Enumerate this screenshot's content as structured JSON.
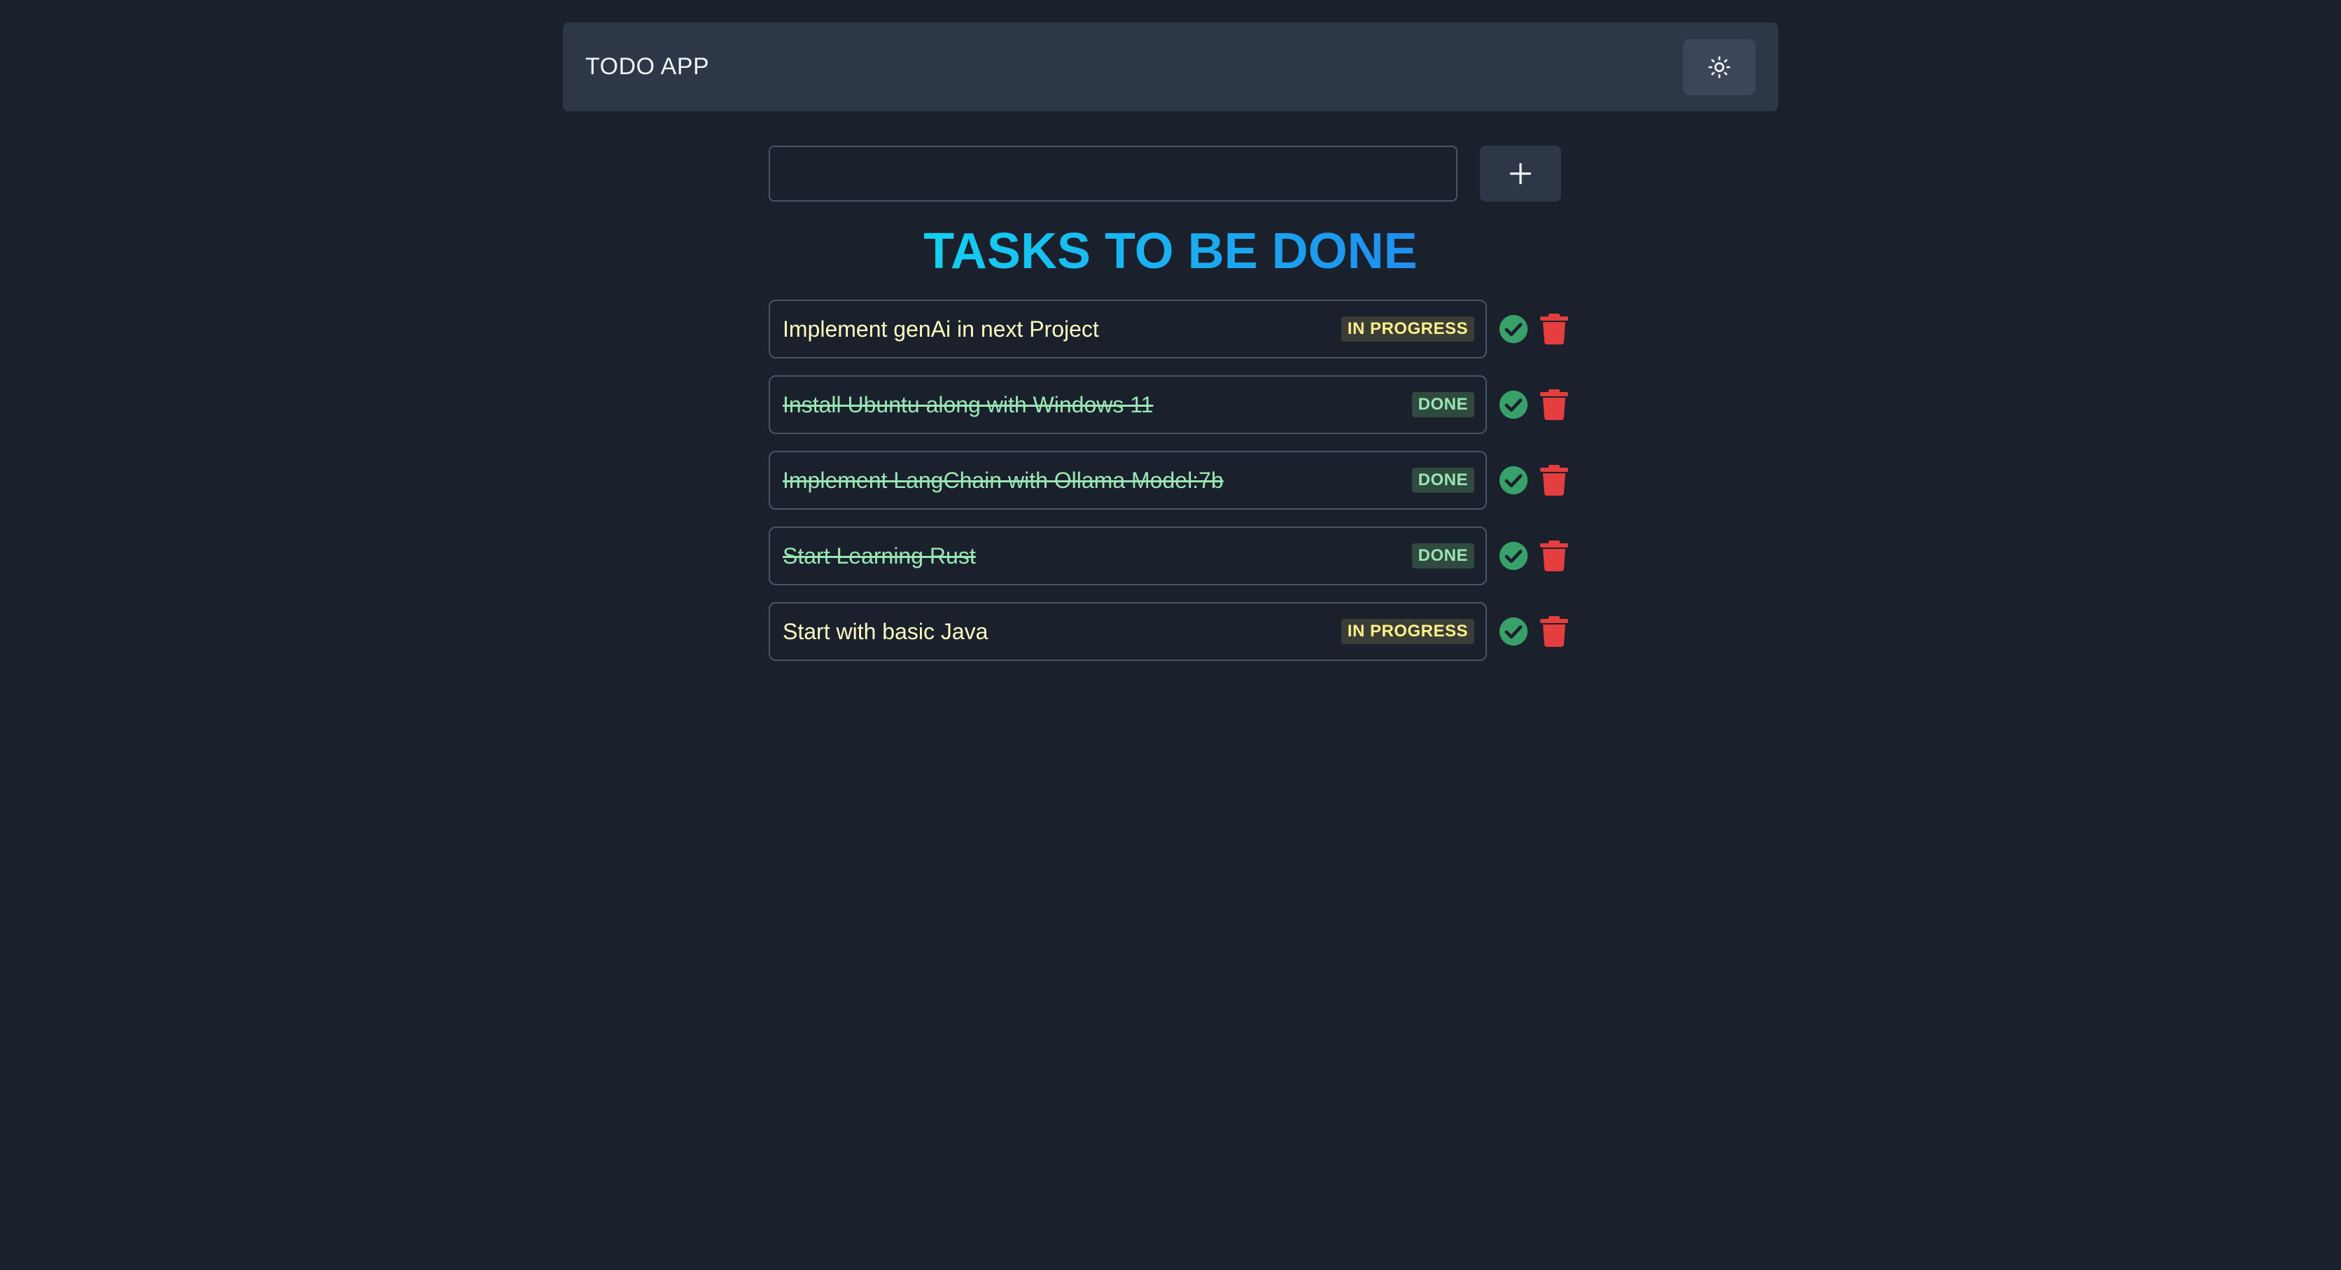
{
  "header": {
    "title": "TODO APP",
    "theme_toggle_icon": "sun-icon"
  },
  "input": {
    "value": "",
    "placeholder": ""
  },
  "add_button": {
    "icon": "plus-icon"
  },
  "heading": "TASKS TO BE DONE",
  "tasks": [
    {
      "text": "Implement genAi in next Project",
      "status": "IN PROGRESS",
      "done": false
    },
    {
      "text": "Install Ubuntu along with Windows 11",
      "status": "DONE",
      "done": true
    },
    {
      "text": "Implement LangChain with Ollama Model:7b",
      "status": "DONE",
      "done": true
    },
    {
      "text": "Start Learning Rust",
      "status": "DONE",
      "done": true
    },
    {
      "text": "Start with basic Java",
      "status": "IN PROGRESS",
      "done": false
    }
  ],
  "colors": {
    "background": "#1a202c",
    "navbar": "#2d3748",
    "heading_gradient_start": "#14d1f0",
    "heading_gradient_end": "#1f8ef0",
    "check": "#38a169",
    "trash": "#e53e3e",
    "in_progress_text": "#faf089",
    "done_text": "#9ae6b4"
  }
}
